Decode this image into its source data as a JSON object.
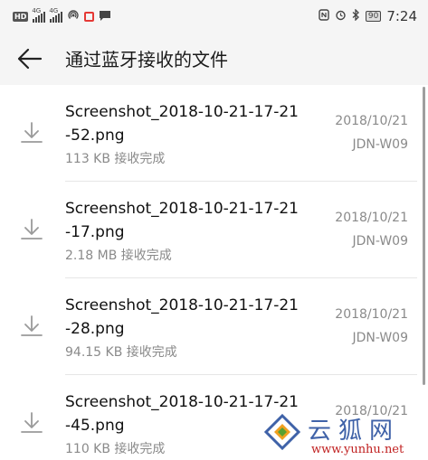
{
  "status_bar": {
    "hd_badge": "HD",
    "network_1": "4G",
    "network_2": "4G",
    "battery": "90",
    "time": "7:24"
  },
  "header": {
    "title": "通过蓝牙接收的文件"
  },
  "files": [
    {
      "name": "Screenshot_2018-10-21-17-21-52.png",
      "meta": "113 KB 接收完成",
      "date": "2018/10/21",
      "device": "JDN-W09"
    },
    {
      "name": "Screenshot_2018-10-21-17-21-17.png",
      "meta": "2.18 MB 接收完成",
      "date": "2018/10/21",
      "device": "JDN-W09"
    },
    {
      "name": "Screenshot_2018-10-21-17-21-28.png",
      "meta": "94.15 KB 接收完成",
      "date": "2018/10/21",
      "device": "JDN-W09"
    },
    {
      "name": "Screenshot_2018-10-21-17-21-45.png",
      "meta": "110 KB 接收完成",
      "date": "2018/10/21",
      "device": ""
    }
  ],
  "watermark": {
    "cn_text": "云狐网",
    "url": "www.yunhu.net"
  },
  "colors": {
    "accent_red": "#e53935",
    "watermark_blue": "#3f62a8",
    "watermark_red": "#c02020",
    "secondary_text": "#8a8a8a"
  },
  "icons": {
    "back": "back-arrow-icon",
    "download": "download-icon"
  }
}
